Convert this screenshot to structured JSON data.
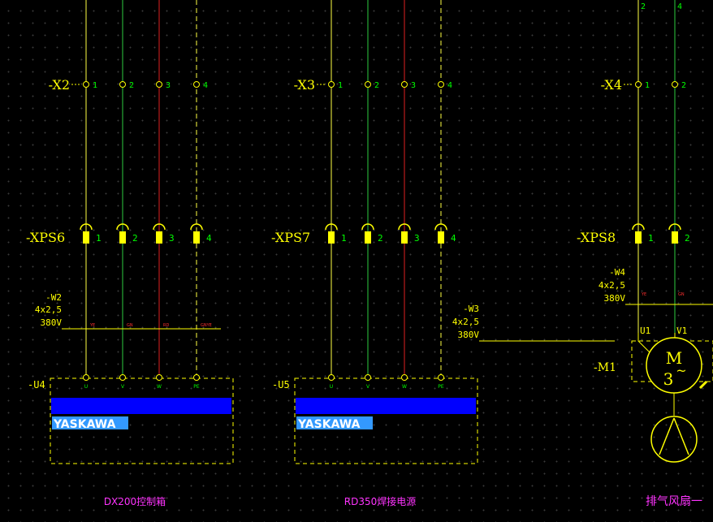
{
  "colors": {
    "yellow": "#ffff00",
    "green": "#00ff00",
    "red": "#ff2020",
    "magenta": "#ff33ff",
    "blue": "#0000ff",
    "wire_green": "#2ecc40",
    "wire_red": "#e02020",
    "wire_yellow": "#ffff44",
    "logo_text": "#ffffff",
    "logo_bg": "#3399ff"
  },
  "groups": [
    {
      "terminal": "-X2",
      "connector": "-XPS6",
      "cable": {
        "name": "-W2",
        "spec": "4x2,5",
        "voltage": "380V"
      },
      "cable_cores": [
        "YE",
        "GN",
        "RD",
        "GNYE"
      ],
      "terminal_pins": [
        "1",
        "2",
        "3",
        "4"
      ],
      "connector_pins": [
        "1",
        "2",
        "3",
        "4"
      ],
      "device": "-U4",
      "device_pins": [
        "U",
        "V",
        "W",
        "PE"
      ],
      "brand": "YASKAWA",
      "caption": "DX200控制箱"
    },
    {
      "terminal": "-X3",
      "connector": "-XPS7",
      "cable": {
        "name": "-W3",
        "spec": "4x2,5",
        "voltage": "380V"
      },
      "cable_cores": [],
      "terminal_pins": [
        "1",
        "2",
        "3",
        "4"
      ],
      "connector_pins": [
        "1",
        "2",
        "3",
        "4"
      ],
      "device": "-U5",
      "device_pins": [
        "U",
        "V",
        "W",
        "PE"
      ],
      "brand": "YASKAWA",
      "caption": "RD350焊接电源"
    },
    {
      "terminal": "-X4",
      "connector": "-XPS8",
      "cable": {
        "name": "-W4",
        "spec": "4x2,5",
        "voltage": "380V"
      },
      "cable_cores": [
        "YE",
        "GN"
      ],
      "terminal_pins": [
        "1",
        "2"
      ],
      "top_pins": [
        "2",
        "4"
      ],
      "connector_pins": [
        "1",
        "2"
      ],
      "device": "-M1",
      "motor_pins": [
        "U1",
        "V1"
      ],
      "motor_symbol": "M",
      "motor_phases": "3",
      "motor_tilde": "~",
      "caption": "排气风扇一"
    }
  ]
}
